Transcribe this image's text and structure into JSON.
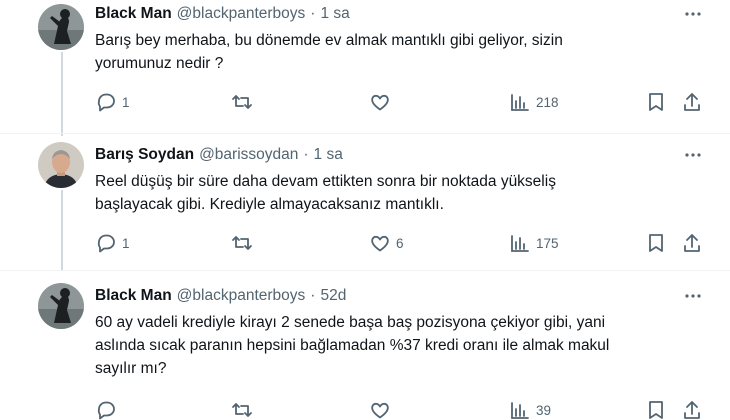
{
  "tweets": [
    {
      "name": "Black Man",
      "handle": "@blackpanterboys",
      "separator": "·",
      "time": "1 sa",
      "text_lines": [
        "Barış bey merhaba, bu dönemde ev almak mantıklı gibi geliyor, sizin",
        "yorumunuz nedir ?"
      ],
      "replies": "1",
      "reposts": "",
      "likes": "",
      "views": "218",
      "avatar": "silhouette-avatar"
    },
    {
      "name": "Barış Soydan",
      "handle": "@barissoydan",
      "separator": "·",
      "time": "1 sa",
      "text_lines": [
        "Reel düşüş bir süre daha devam ettikten sonra bir noktada yükseliş",
        "başlayacak gibi. Krediyle almayacaksanız mantıklı."
      ],
      "replies": "1",
      "reposts": "",
      "likes": "6",
      "views": "175",
      "avatar": "portrait-avatar"
    },
    {
      "name": "Black Man",
      "handle": "@blackpanterboys",
      "separator": "·",
      "time": "52d",
      "text_lines": [
        "60 ay vadeli krediyle kirayı 2 senede başa baş pozisyona çekiyor gibi, yani",
        "aslında sıcak paranın hepsini bağlamadan %37 kredi oranı ile almak makul",
        "sayılır mı?"
      ],
      "replies": "",
      "reposts": "",
      "likes": "",
      "views": "39",
      "avatar": "silhouette-avatar"
    }
  ],
  "icons": {
    "reply": "reply-icon",
    "repost": "repost-icon",
    "like": "like-icon",
    "views": "views-icon",
    "bookmark": "bookmark-icon",
    "share": "share-icon",
    "more": "more-icon"
  },
  "colors": {
    "text": "#0f1419",
    "secondary": "#536471",
    "thread_line": "#cfd9de",
    "divider": "#eff3f4"
  }
}
